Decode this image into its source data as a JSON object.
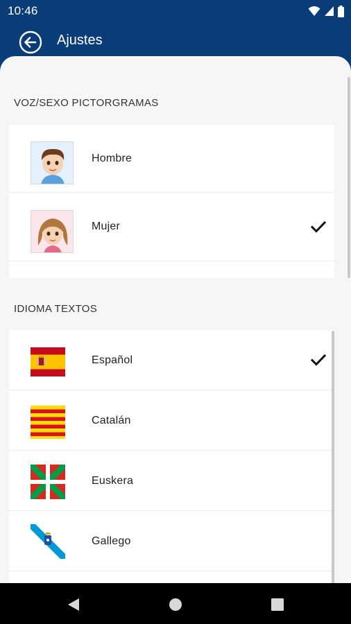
{
  "status_bar": {
    "time": "10:46",
    "icons": [
      "wifi-icon",
      "signal-icon",
      "battery-icon"
    ]
  },
  "toolbar": {
    "title": "Ajustes",
    "back_icon": "arrow-left-circle-icon"
  },
  "sections": {
    "voice": {
      "header": "VOZ/SEXO PICTORGRAMAS",
      "items": [
        {
          "label": "Hombre",
          "icon": "boy-avatar-icon",
          "selected": false
        },
        {
          "label": "Mujer",
          "icon": "girl-avatar-icon",
          "selected": true
        }
      ]
    },
    "language": {
      "header": "IDIOMA TEXTOS",
      "items": [
        {
          "label": "Español",
          "icon": "spain-flag-icon",
          "selected": true
        },
        {
          "label": "Catalán",
          "icon": "catalonia-flag-icon",
          "selected": false
        },
        {
          "label": "Euskera",
          "icon": "basque-flag-icon",
          "selected": false
        },
        {
          "label": "Gallego",
          "icon": "galicia-flag-icon",
          "selected": false
        }
      ]
    }
  },
  "nav_bar": {
    "buttons": [
      "back-triangle-icon",
      "home-circle-icon",
      "recents-square-icon"
    ]
  },
  "colors": {
    "app_bar": "#0a3c78",
    "content_background": "#f6f6f6",
    "card_background": "#ffffff",
    "nav_bar": "#000000"
  }
}
